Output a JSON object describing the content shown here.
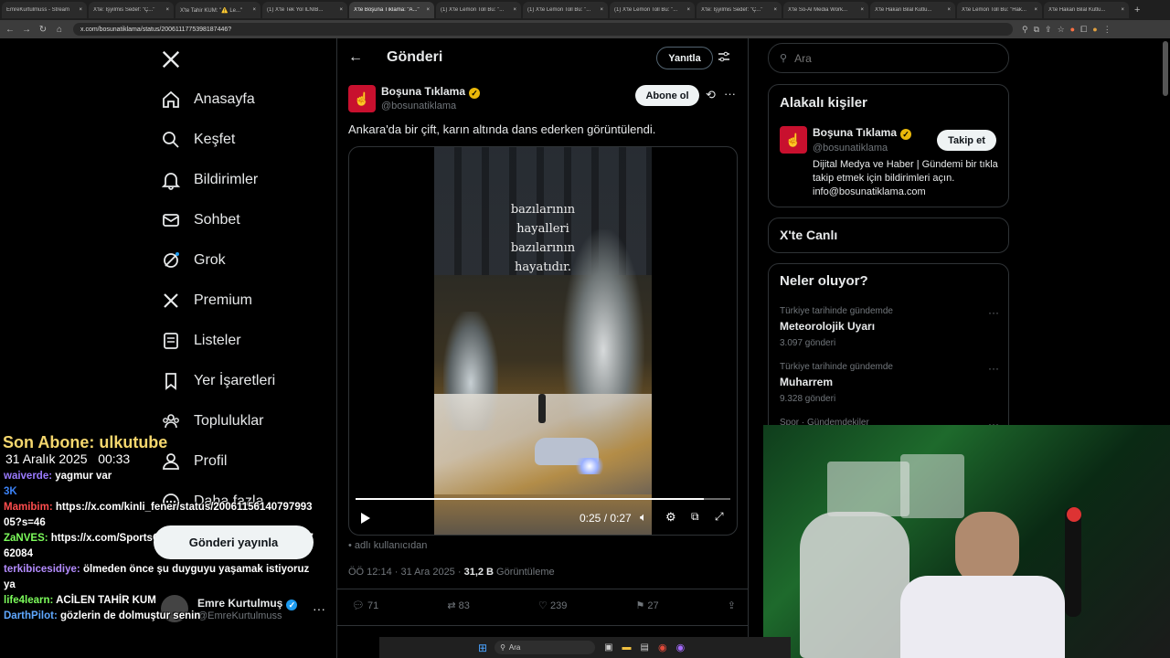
{
  "browser": {
    "tabs": [
      {
        "title": "EmreKurtulmuss - Stream"
      },
      {
        "title": "X'te: İşyilmis Sedef: \"Ç...\""
      },
      {
        "title": "X'te Tahir KUM: \"⚠️ Le...\""
      },
      {
        "title": "(1) X'te Tek Yol ILNIB..."
      },
      {
        "title": "X'te Boşuna Tıklama: \"A...\"",
        "active": true
      },
      {
        "title": "(1) X'te Lemon Toll Bu: \"..."
      },
      {
        "title": "(1) X'te Lemon Toll Bu: \"..."
      },
      {
        "title": "(1) X'te Lemon Toll Bu: \"..."
      },
      {
        "title": "X'te: İşyilmis Sedef: \"Ç...\""
      },
      {
        "title": "X'te So-Al Media Work..."
      },
      {
        "title": "X'te Hakan Bilal Kutlu..."
      },
      {
        "title": "X'te Lemon Toll Bu: \"Hak..."
      },
      {
        "title": "X'te Hakan Bilal Kutlu..."
      }
    ],
    "url": "x.com/bosunatiklama/status/2006111775398187446?"
  },
  "sidebar": {
    "items": [
      {
        "label": "Anasayfa",
        "icon": "home-icon"
      },
      {
        "label": "Keşfet",
        "icon": "search-icon"
      },
      {
        "label": "Bildirimler",
        "icon": "bell-icon"
      },
      {
        "label": "Sohbet",
        "icon": "mail-icon"
      },
      {
        "label": "Grok",
        "icon": "grok-icon"
      },
      {
        "label": "Premium",
        "icon": "x-logo-icon"
      },
      {
        "label": "Listeler",
        "icon": "list-icon"
      },
      {
        "label": "Yer İşaretleri",
        "icon": "bookmark-icon"
      },
      {
        "label": "Topluluklar",
        "icon": "community-icon"
      },
      {
        "label": "Profil",
        "icon": "profile-icon"
      },
      {
        "label": "Daha fazla",
        "icon": "more-circle-icon"
      }
    ],
    "post_button": "Gönderi yayınla",
    "account": {
      "name": "Emre Kurtulmuş",
      "handle": "@EmreKurtulmuss"
    }
  },
  "main": {
    "header_title": "Gönderi",
    "reply_button": "Yanıtla",
    "author": {
      "name": "Boşuna Tıklama",
      "handle": "@bosunatiklama"
    },
    "subscribe_button": "Abone ol",
    "text": "Ankara'da bir çift, karın altında dans ederken görüntülendi.",
    "video": {
      "overlay_text": [
        "bazılarının",
        "hayalleri",
        "bazılarının",
        "hayatıdır."
      ],
      "time": "0:25 / 0:27",
      "progress": 0.93
    },
    "source_note": "adlı kullanıcıdan",
    "timestamp": "ÖÖ 12:14 · 31 Ara 2025 · ",
    "views_count": "31,2 B",
    "views_label": " Görüntüleme",
    "stats": {
      "replies": "71",
      "reposts": "83",
      "likes": "239",
      "bookmarks": "27"
    }
  },
  "right": {
    "search_placeholder": "Ara",
    "relevant_title": "Alakalı kişiler",
    "relevant_person": {
      "name": "Boşuna Tıklama",
      "handle": "@bosunatiklama",
      "follow_button": "Takip et",
      "bio": "Dijital Medya ve Haber | Gündemi bir tıkla takip etmek için bildirimleri açın. info@bosunatiklama.com"
    },
    "live_title": "X'te Canlı",
    "trends_title": "Neler oluyor?",
    "trends": [
      {
        "meta": "Türkiye tarihinde gündemde",
        "name": "Meteorolojik Uyarı",
        "count": "3.097 gönderi"
      },
      {
        "meta": "Türkiye tarihinde gündemde",
        "name": "Muharrem",
        "count": "9.328 gönderi"
      },
      {
        "meta": "Spor · Gündemdekiler",
        "name": "",
        "count": ""
      }
    ]
  },
  "overlay": {
    "last_sub": "Son Abone: ulkutube",
    "date": "31 Aralık 2025",
    "time": "00:33",
    "chat": [
      {
        "user": "waiverde:",
        "msg": "yagmur var",
        "color": "#9b7bff"
      },
      {
        "user": "3K",
        "msg": "",
        "color": "#3b82f6"
      },
      {
        "user": "Mamibim:",
        "msg": "https://x.com/kinli_fener/status/2006115614079799305?s=46",
        "color": "#ff4d4d"
      },
      {
        "user": "ZaNVES:",
        "msg": "https://x.com/SportsCubukiu/status/2005953701403762084",
        "color": "#7cfc5b"
      },
      {
        "user": "terkibicesidiye:",
        "msg": "ölmeden önce şu duyguyu yaşamak istiyoruz ya",
        "color": "#b48cff"
      },
      {
        "user": "life4learn:",
        "msg": "ACİLEN TAHİR KUM",
        "color": "#7cfc5b"
      },
      {
        "user": "DarthPilot:",
        "msg": "gözlerin de dolmuştur senin",
        "color": "#5fa8ff"
      }
    ]
  },
  "taskbar": {
    "search_placeholder": "Ara"
  }
}
